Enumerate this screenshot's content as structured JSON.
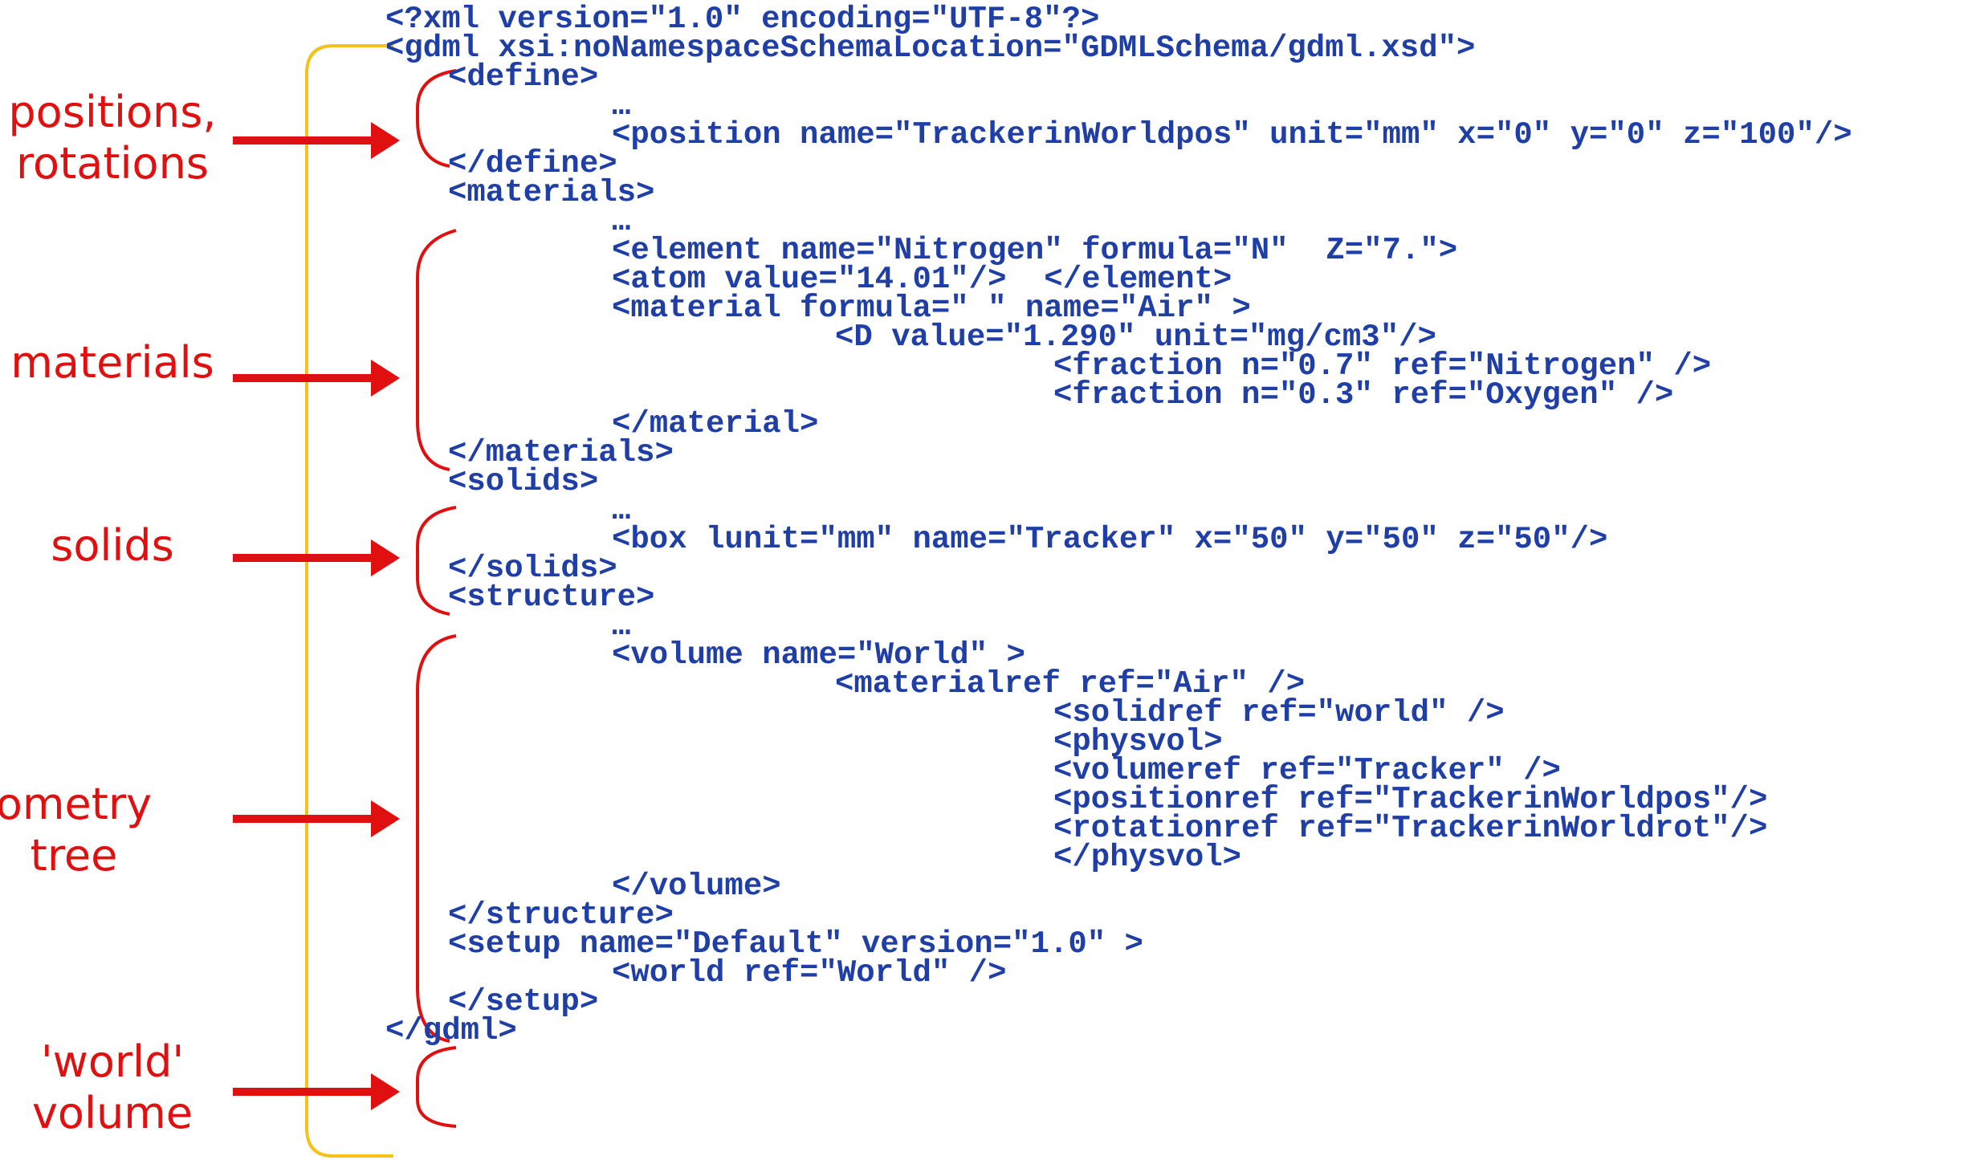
{
  "code_lines": [
    "<?xml version=\"1.0\" encoding=\"UTF-8\"?>",
    "<gdml xsi:noNamespaceSchemaLocation=\"GDMLSchema/gdml.xsd\">",
    "<define>",
    "…",
    "<position name=\"TrackerinWorldpos\" unit=\"mm\" x=\"0\" y=\"0\" z=\"100\"/>",
    "</define>",
    "<materials>",
    "…",
    "<element name=\"Nitrogen\" formula=\"N\"  Z=\"7.\">",
    "<atom value=\"14.01\"/>  </element>",
    "<material formula=\" \" name=\"Air\" >",
    "<D value=\"1.290\" unit=\"mg/cm3\"/>",
    "<fraction n=\"0.7\" ref=\"Nitrogen\" />",
    "<fraction n=\"0.3\" ref=\"Oxygen\" />",
    "</material>",
    "</materials>",
    "<solids>",
    "…",
    "<box lunit=\"mm\" name=\"Tracker\" x=\"50\" y=\"50\" z=\"50\"/>",
    "</solids>",
    "<structure>",
    "…",
    "<volume name=\"World\" >",
    "<materialref ref=\"Air\" />",
    "<solidref ref=\"world\" />",
    "<physvol>",
    "<volumeref ref=\"Tracker\" />",
    "<positionref ref=\"TrackerinWorldpos\"/>",
    "<rotationref ref=\"TrackerinWorldrot\"/>",
    "</physvol>",
    "</volume>",
    "</structure>",
    "<setup name=\"Default\" version=\"1.0\" >",
    "<world ref=\"World\" />",
    "</setup>",
    "</gdml>"
  ],
  "labels": [
    {
      "lines": [
        "positions,",
        "rotations"
      ]
    },
    {
      "lines": [
        "materials"
      ]
    },
    {
      "lines": [
        "solids"
      ]
    },
    {
      "lines": [
        "ometry tree"
      ]
    },
    {
      "lines": [
        "'world'",
        "volume"
      ]
    }
  ],
  "colors": {
    "code": "#1f3fa6",
    "label": "#e01010",
    "arrow": "#e01010",
    "red_bracket": "#e01010",
    "outer_bracket": "#f5c21a"
  }
}
